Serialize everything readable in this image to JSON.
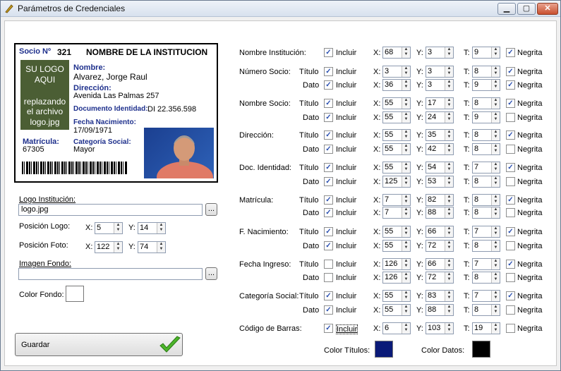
{
  "window": {
    "title": "Parámetros de Credenciales",
    "minimize": "▁",
    "maximize": "▢",
    "close": "✕"
  },
  "card": {
    "socio_label": "Socio Nº",
    "socio_num": "321",
    "institucion": "NOMBRE DE LA INSTITUCION",
    "logo_lines": [
      "SU LOGO",
      "AQUI",
      "replazando",
      "el archivo",
      "logo.jpg"
    ],
    "nombre_label": "Nombre:",
    "nombre": "Alvarez, Jorge Raul",
    "direccion_label": "Dirección:",
    "direccion": "Avenida Las Palmas 257",
    "doc_label": "Documento Identidad:",
    "doc": "DI 22.356.598",
    "fnac_label": "Fecha Nacimiento:",
    "fnac": "17/09/1971",
    "cat_label": "Categoría Social:",
    "cat": "Mayor",
    "matricula_label": "Matrícula:",
    "matricula": "67305"
  },
  "left": {
    "logo_inst_label": "Logo Institución:",
    "logo_inst_value": "logo.jpg",
    "browse": "...",
    "pos_logo_label": "Posición Logo:",
    "pos_logo_x": "5",
    "pos_logo_y": "14",
    "pos_foto_label": "Posición Foto:",
    "pos_foto_x": "122",
    "pos_foto_y": "74",
    "imagen_fondo_label": "Imagen Fondo:",
    "imagen_fondo_value": "",
    "color_fondo_label": "Color Fondo:",
    "color_fondo": "#ffffff",
    "guardar": "Guardar",
    "x_label": "X:",
    "y_label": "Y:"
  },
  "labels": {
    "titulo": "Título",
    "dato": "Dato",
    "incluir": "Incluir",
    "x": "X:",
    "y": "Y:",
    "t": "T:",
    "negrita": "Negrita"
  },
  "fields": [
    {
      "name": "Nombre Institución:",
      "rows": [
        {
          "sub": "",
          "inc": true,
          "x": "68",
          "y": "3",
          "t": "9",
          "neg": true
        }
      ]
    },
    {
      "name": "Número Socio:",
      "rows": [
        {
          "sub": "Título",
          "inc": true,
          "x": "3",
          "y": "3",
          "t": "8",
          "neg": true
        },
        {
          "sub": "Dato",
          "inc": true,
          "x": "36",
          "y": "3",
          "t": "9",
          "neg": true
        }
      ]
    },
    {
      "name": "Nombre Socio:",
      "rows": [
        {
          "sub": "Título",
          "inc": true,
          "x": "55",
          "y": "17",
          "t": "8",
          "neg": true
        },
        {
          "sub": "Dato",
          "inc": true,
          "x": "55",
          "y": "24",
          "t": "9",
          "neg": false
        }
      ]
    },
    {
      "name": "Dirección:",
      "rows": [
        {
          "sub": "Título",
          "inc": true,
          "x": "55",
          "y": "35",
          "t": "8",
          "neg": true
        },
        {
          "sub": "Dato",
          "inc": true,
          "x": "55",
          "y": "42",
          "t": "8",
          "neg": false
        }
      ]
    },
    {
      "name": "Doc. Identidad:",
      "rows": [
        {
          "sub": "Título",
          "inc": true,
          "x": "55",
          "y": "54",
          "t": "7",
          "neg": true
        },
        {
          "sub": "Dato",
          "inc": true,
          "x": "125",
          "y": "53",
          "t": "8",
          "neg": false
        }
      ]
    },
    {
      "name": "Matrícula:",
      "rows": [
        {
          "sub": "Título",
          "inc": true,
          "x": "7",
          "y": "82",
          "t": "8",
          "neg": true
        },
        {
          "sub": "Dato",
          "inc": true,
          "x": "7",
          "y": "88",
          "t": "8",
          "neg": false
        }
      ]
    },
    {
      "name": "F. Nacimiento:",
      "rows": [
        {
          "sub": "Título",
          "inc": true,
          "x": "55",
          "y": "66",
          "t": "7",
          "neg": true
        },
        {
          "sub": "Dato",
          "inc": true,
          "x": "55",
          "y": "72",
          "t": "8",
          "neg": false
        }
      ]
    },
    {
      "name": "Fecha Ingreso:",
      "rows": [
        {
          "sub": "Título",
          "inc": false,
          "x": "126",
          "y": "66",
          "t": "7",
          "neg": true
        },
        {
          "sub": "Dato",
          "inc": false,
          "x": "126",
          "y": "72",
          "t": "8",
          "neg": false
        }
      ]
    },
    {
      "name": "Categoría Social:",
      "rows": [
        {
          "sub": "Título",
          "inc": true,
          "x": "55",
          "y": "83",
          "t": "7",
          "neg": true
        },
        {
          "sub": "Dato",
          "inc": true,
          "x": "55",
          "y": "88",
          "t": "8",
          "neg": false
        }
      ]
    },
    {
      "name": "Código de Barras:",
      "rows": [
        {
          "sub": "",
          "inc": true,
          "x": "6",
          "y": "103",
          "t": "19",
          "neg": false
        }
      ]
    }
  ],
  "colors": {
    "titulos_label": "Color Títulos:",
    "titulos": "#0a1a78",
    "datos_label": "Color Datos:",
    "datos": "#000000"
  }
}
